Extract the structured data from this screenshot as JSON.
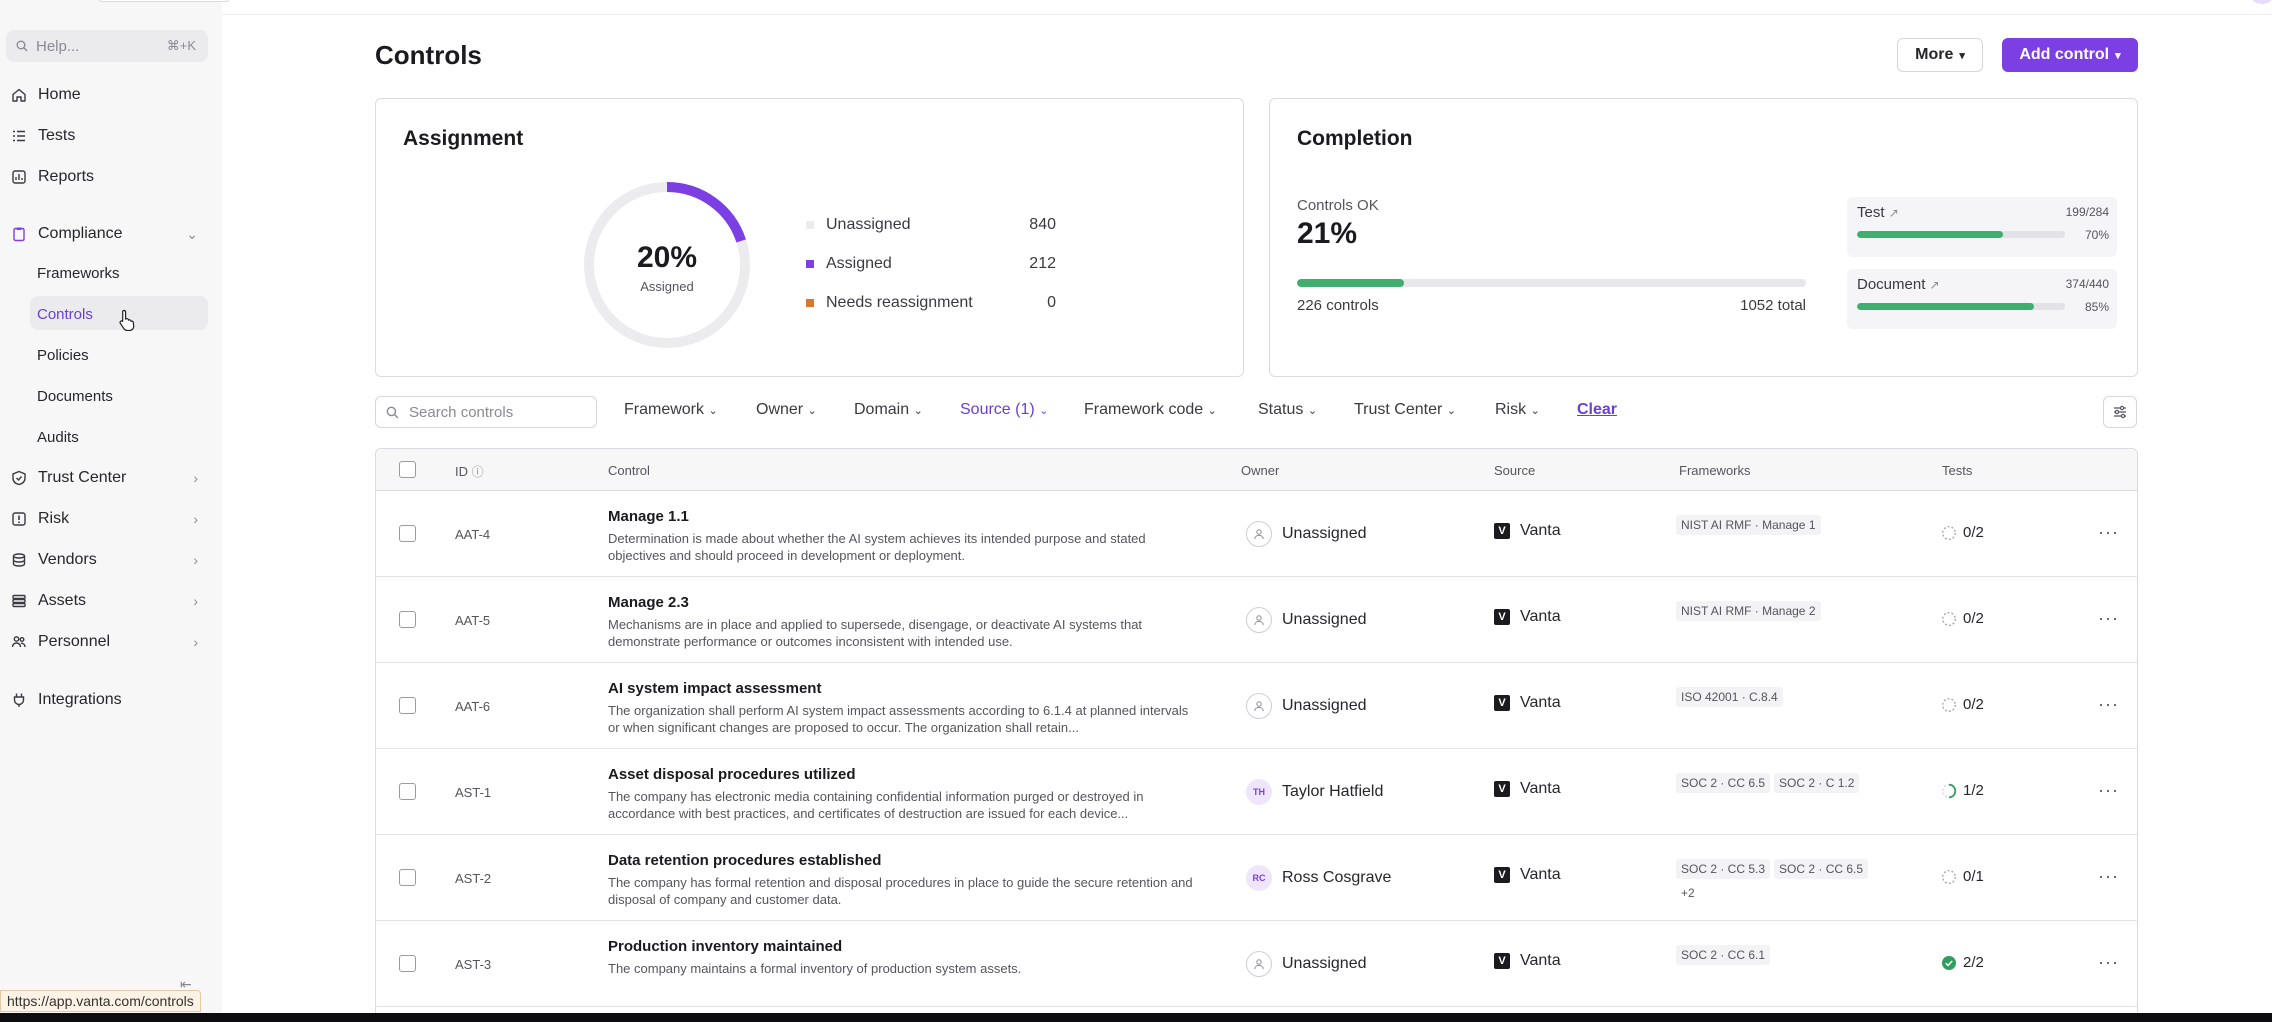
{
  "sidebar": {
    "help_placeholder": "Help...",
    "help_shortcut": "⌘+K",
    "items": [
      {
        "label": "Home",
        "icon": "home-icon"
      },
      {
        "label": "Tests",
        "icon": "tests-icon"
      },
      {
        "label": "Reports",
        "icon": "reports-icon"
      },
      {
        "label": "Compliance",
        "icon": "clipboard-icon"
      },
      {
        "label": "Trust Center",
        "icon": "shield-icon"
      },
      {
        "label": "Risk",
        "icon": "risk-icon"
      },
      {
        "label": "Vendors",
        "icon": "database-icon"
      },
      {
        "label": "Assets",
        "icon": "stack-icon"
      },
      {
        "label": "Personnel",
        "icon": "people-icon"
      },
      {
        "label": "Integrations",
        "icon": "plug-icon"
      }
    ],
    "compliance_sub": [
      "Frameworks",
      "Controls",
      "Policies",
      "Documents",
      "Audits"
    ],
    "status_url": "https://app.vanta.com/controls"
  },
  "header": {
    "title": "Controls",
    "more_label": "More",
    "add_label": "Add control"
  },
  "assignment": {
    "title": "Assignment",
    "percent": 20,
    "percent_label": "20%",
    "sub_label": "Assigned",
    "legend": [
      {
        "label": "Unassigned",
        "count": "840",
        "color": "#ececef"
      },
      {
        "label": "Assigned",
        "count": "212",
        "color": "#7b3fe4"
      },
      {
        "label": "Needs reassignment",
        "count": "0",
        "color": "#d9772e"
      }
    ]
  },
  "completion": {
    "title": "Completion",
    "ok_label": "Controls OK",
    "ok_pct": "21%",
    "ok_fraction": 0.21,
    "controls_count": "226 controls",
    "total": "1052 total",
    "test": {
      "label": "Test",
      "fraction": "199/284",
      "pct": "70%",
      "value": 0.7
    },
    "document": {
      "label": "Document",
      "fraction": "374/440",
      "pct": "85%",
      "value": 0.85
    }
  },
  "filters": {
    "search_placeholder": "Search controls",
    "items": [
      "Framework",
      "Owner",
      "Domain",
      "Source (1)",
      "Framework code",
      "Status",
      "Trust Center",
      "Risk"
    ],
    "clear": "Clear"
  },
  "table": {
    "headers": [
      "ID",
      "Control",
      "Owner",
      "Source",
      "Frameworks",
      "Tests"
    ],
    "rows": [
      {
        "id": "AAT-4",
        "title": "Manage 1.1",
        "desc": "Determination is made about whether the AI system achieves its intended purpose and stated objectives and should proceed in development or deployment.",
        "owner": "Unassigned",
        "initials": "",
        "source": "Vanta",
        "frameworks": [
          "NIST AI RMF · Manage 1"
        ],
        "extra": "",
        "tests": "0/2",
        "state": "pending"
      },
      {
        "id": "AAT-5",
        "title": "Manage 2.3",
        "desc": "Mechanisms are in place and applied to supersede, disengage, or deactivate AI systems that demonstrate performance or outcomes inconsistent with intended use.",
        "owner": "Unassigned",
        "initials": "",
        "source": "Vanta",
        "frameworks": [
          "NIST AI RMF · Manage 2"
        ],
        "extra": "",
        "tests": "0/2",
        "state": "pending"
      },
      {
        "id": "AAT-6",
        "title": "AI system impact assessment",
        "desc": "The organization shall perform AI system impact assessments according to 6.1.4 at planned intervals or when significant changes are proposed to occur. The organization shall retain...",
        "owner": "Unassigned",
        "initials": "",
        "source": "Vanta",
        "frameworks": [
          "ISO 42001 · C.8.4"
        ],
        "extra": "",
        "tests": "0/2",
        "state": "pending"
      },
      {
        "id": "AST-1",
        "title": "Asset disposal procedures utilized",
        "desc": "The company has electronic media containing confidential information purged or destroyed in accordance with best practices, and certificates of destruction are issued for each device...",
        "owner": "Taylor Hatfield",
        "initials": "TH",
        "source": "Vanta",
        "frameworks": [
          "SOC 2 · CC 6.5",
          "SOC 2 · C 1.2"
        ],
        "extra": "",
        "tests": "1/2",
        "state": "partial"
      },
      {
        "id": "AST-2",
        "title": "Data retention procedures established",
        "desc": "The company has formal retention and disposal procedures in place to guide the secure retention and disposal of company and customer data.",
        "owner": "Ross Cosgrave",
        "initials": "RC",
        "source": "Vanta",
        "frameworks": [
          "SOC 2 · CC 5.3",
          "SOC 2 · CC 6.5"
        ],
        "extra": "+2",
        "tests": "0/1",
        "state": "pending"
      },
      {
        "id": "AST-3",
        "title": "Production inventory maintained",
        "desc": "The company maintains a formal inventory of production system assets.",
        "owner": "Unassigned",
        "initials": "",
        "source": "Vanta",
        "frameworks": [
          "SOC 2 · CC 6.1"
        ],
        "extra": "",
        "tests": "2/2",
        "state": "done"
      }
    ]
  }
}
